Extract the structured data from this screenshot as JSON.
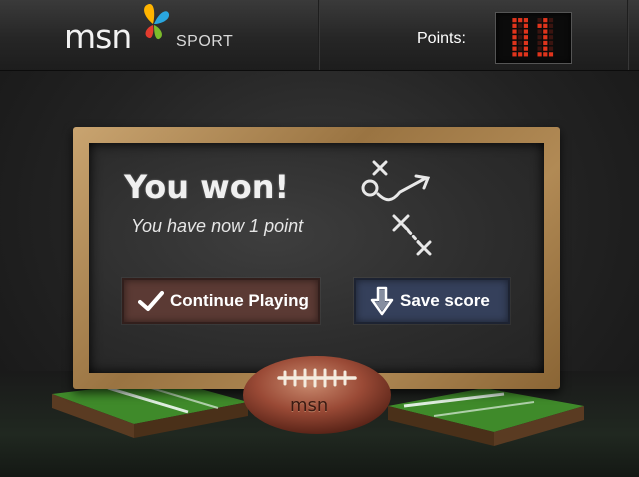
{
  "brand": {
    "name": "msn",
    "section": "SPORT"
  },
  "points": {
    "label": "Points:",
    "value": 1
  },
  "result": {
    "title": "You won!",
    "message": "You have now 1 point"
  },
  "actions": {
    "continue_label": "Continue Playing",
    "save_label": "Save score"
  },
  "ball": {
    "label": "msn"
  },
  "colors": {
    "continue_bg": "#5b3a34",
    "save_bg": "#35405b",
    "led_on": "#e0341c",
    "led_off": "#3a1410"
  },
  "icons": {
    "continue": "checkmark-icon",
    "save": "download-arrow-icon"
  }
}
